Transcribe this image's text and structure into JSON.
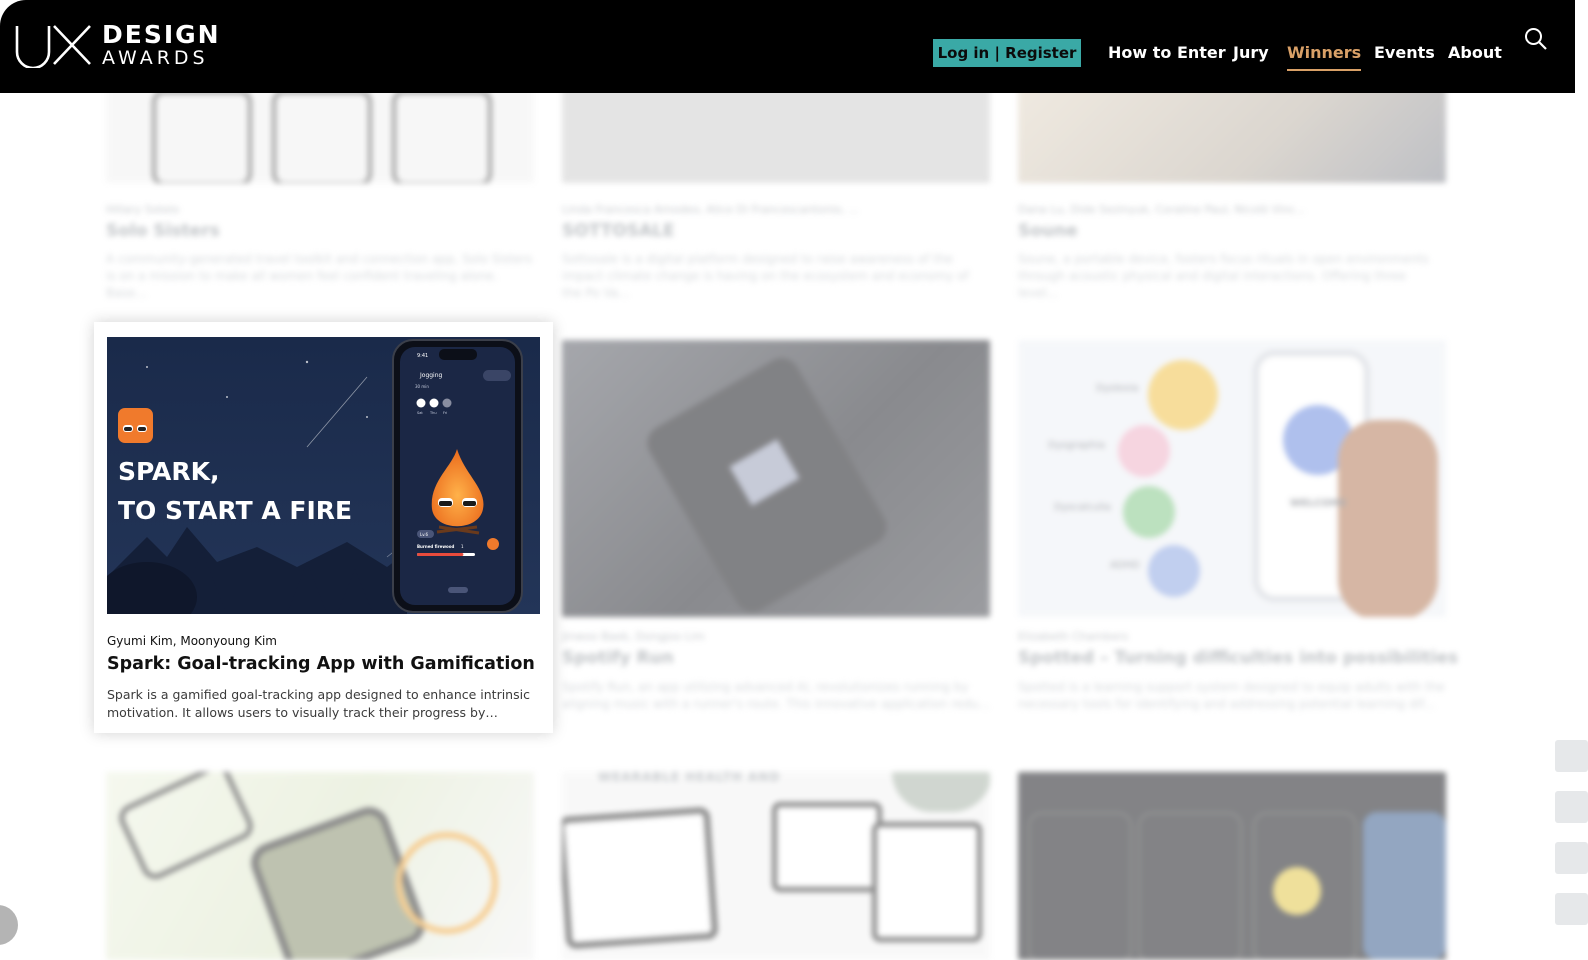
{
  "header": {
    "logo": {
      "mark": "UX",
      "line1": "DESIGN",
      "line2": "AWARDS"
    },
    "login_label": "Log in | Register",
    "nav": [
      {
        "label": "How to Enter",
        "active": false
      },
      {
        "label": "Jury",
        "active": false
      },
      {
        "label": "Winners",
        "active": true
      },
      {
        "label": "Events",
        "active": false
      },
      {
        "label": "About",
        "active": false
      }
    ],
    "search_icon": "search-icon",
    "accent_color": "#d9a067",
    "login_bg_color": "#3aa9a6"
  },
  "background_cards": [
    {
      "authors": "Hillary Sotelo",
      "title": "Solo Sisters",
      "desc": "A community-generated travel toolkit and connection app, Solo Sisters is on a mission to make all women feel confident traveling alone. Base..."
    },
    {
      "authors": "Linda Francesca Amodeo, Alice Di Francescantonio, ...",
      "title": "SOTTOSALE",
      "desc": "Sottosale is a digital platform designed to raise awareness of the impact climate change is having on the ecosystem and economy of the Po Va..."
    },
    {
      "authors": "Dana Lu, Dide Sezinyuk, Coraline Paul, Nicolò Vinc...",
      "title": "Soune",
      "desc": "Soune, a portable device, fosters focus rituals in open environments through acoustic physical and digital interactions. Offering three level..."
    },
    {
      "authors": "Jinwoo Baek, Dongjoo Lim",
      "title": "Spotify Run",
      "desc": "Spotify Run, an app utilizing advanced AI, revolutionizes running by aligning music with a runner's route. This innovative application redu..."
    },
    {
      "authors": "Elizabeth Chambers",
      "title": "Spotted – Turning difficulties into possibilities",
      "desc": "Spotted is a learning support system designed to equip adults with the necessary tools for identifying and addressing potential learning dif..."
    }
  ],
  "background_labels": {
    "dyslexia": "Dyslexia",
    "dysgraphia": "Dysgraphia",
    "dyscalculia": "Dyscalculia",
    "adhd": "ADHD",
    "welcome": "WELCOME",
    "banner_text": "WEARABLE HEALTH AND"
  },
  "focused_card": {
    "authors": "Gyumi Kim, Moonyoung Kim",
    "title": "Spark: Goal-tracking App with Gamification",
    "desc": "Spark is a gamified goal-tracking app designed to enhance intrinsic motivation. It allows users to visually track their progress by adding fuel...",
    "image": {
      "headline_1": "SPARK,",
      "headline_2": "TO START A FIRE",
      "phone_time": "9:41",
      "phone_screen_title": "Jogging",
      "phone_screen_sub": "30 min",
      "day_labels": [
        "Sat",
        "Thu",
        "Fri"
      ],
      "level_label": "Lv.6",
      "burned_label": "Burned firewood",
      "burned_value": "1",
      "progress_fraction": 0.8
    }
  },
  "side_social_icons": [
    "send-icon",
    "linkedin-icon",
    "instagram-icon",
    "youtube-icon"
  ]
}
